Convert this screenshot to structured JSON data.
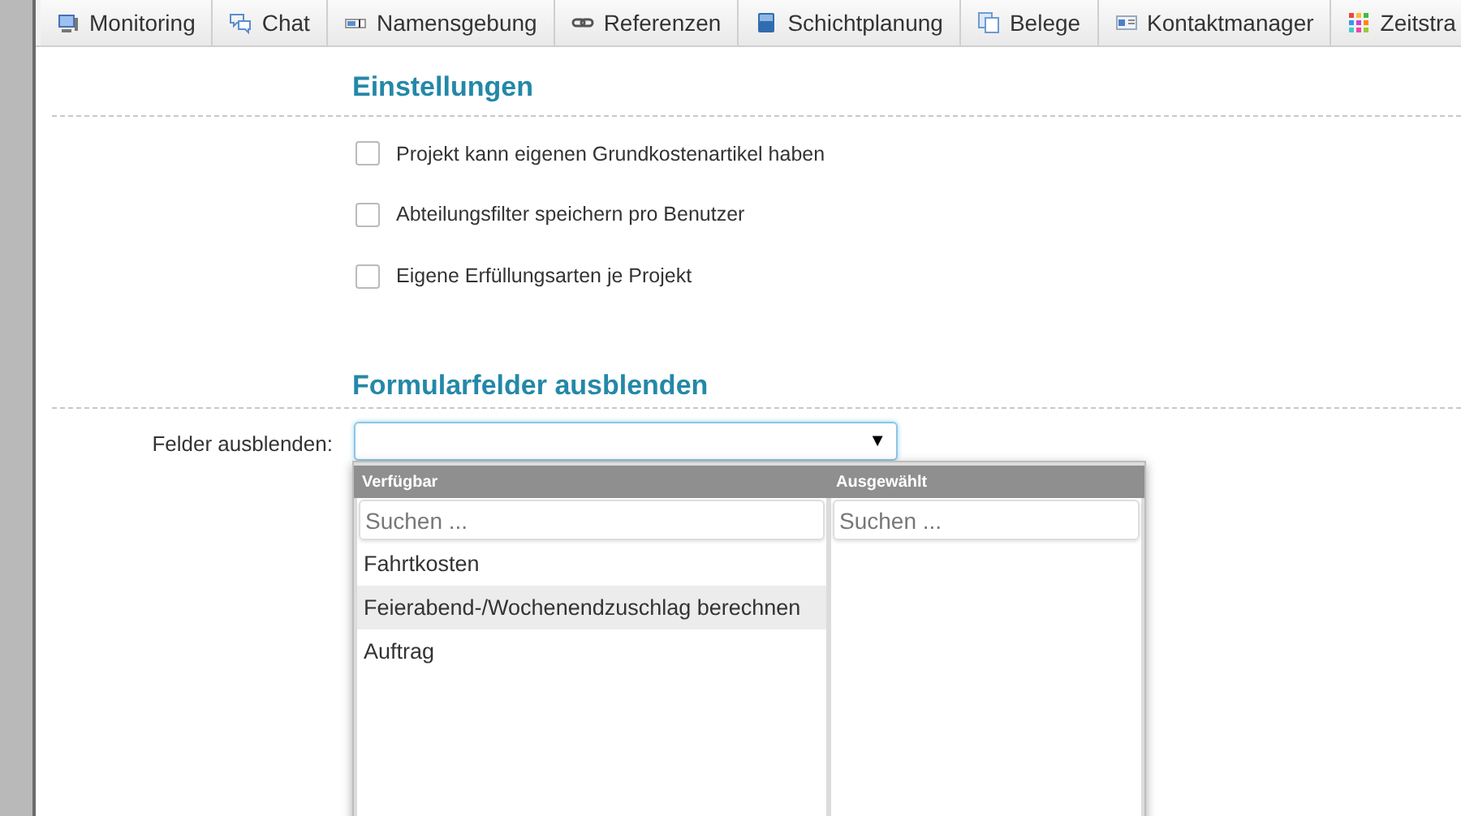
{
  "tabs": [
    {
      "label": "Monitoring",
      "selected": false
    },
    {
      "label": "Chat",
      "selected": false
    },
    {
      "label": "Namensgebung",
      "selected": false
    },
    {
      "label": "Referenzen",
      "selected": false
    },
    {
      "label": "Schichtplanung",
      "selected": false
    },
    {
      "label": "Belege",
      "selected": false
    },
    {
      "label": "Kontaktmanager",
      "selected": false
    },
    {
      "label": "Zeitstra",
      "selected": false
    }
  ],
  "settings": {
    "title": "Einstellungen",
    "options": [
      {
        "label": "Projekt kann eigenen Grundkostenartikel haben",
        "checked": false
      },
      {
        "label": "Abteilungsfilter speichern pro Benutzer",
        "checked": false
      },
      {
        "label": "Eigene Erfüllungsarten je Projekt",
        "checked": false
      }
    ]
  },
  "hide_fields": {
    "title": "Formularfelder ausblenden",
    "label": "Felder ausblenden:",
    "dropdown_arrow": "▼",
    "expanded": true,
    "available": {
      "header": "Verfügbar",
      "search_placeholder": "Suchen ...",
      "items": [
        {
          "label": "Fahrtkosten",
          "selected": false
        },
        {
          "label": "Feierabend-/Wochenendzuschlag berechnen",
          "selected": true
        },
        {
          "label": "Auftrag",
          "selected": false
        }
      ]
    },
    "chosen": {
      "header": "Ausgewählt",
      "search_placeholder": "Suchen ..."
    }
  }
}
